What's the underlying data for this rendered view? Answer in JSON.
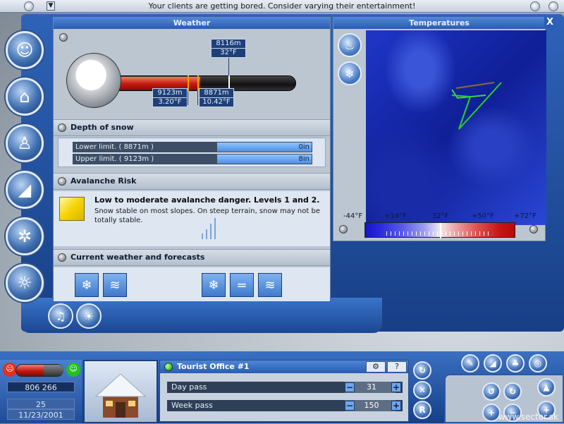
{
  "notification": {
    "text": "Your clients are getting bored. Consider varying their entertainment!"
  },
  "weather": {
    "title": "Weather",
    "gauge": {
      "current_altitude": "8116m",
      "current_temp": "32°F",
      "lower_altitude": "9123m",
      "lower_temp": "3.20°F",
      "upper_altitude": "8871m",
      "upper_temp": "10.42°F"
    },
    "depth": {
      "heading": "Depth of snow",
      "rows": [
        {
          "label": "Lower limit. ( 8871m )",
          "value": "0in"
        },
        {
          "label": "Upper limit. ( 9123m )",
          "value": "8in"
        }
      ]
    },
    "avalanche": {
      "heading": "Avalanche Risk",
      "title": "Low to moderate avalanche danger. Levels 1 and 2.",
      "text": "Snow stable on most slopes. On steep terrain, snow may not be totally stable.",
      "level": 2
    },
    "forecast": {
      "heading": "Current weather and forecasts",
      "icons": [
        "snowflake-icon",
        "wind-icon",
        "snowflake-icon",
        "thermometer-equal-icon",
        "wind-icon"
      ]
    }
  },
  "temperatures": {
    "title": "Temperatures",
    "close": "X",
    "scale": [
      "-44°F",
      "+14°F",
      "32°F",
      "+50°F",
      "+72°F"
    ]
  },
  "status": {
    "money": "806 266",
    "day": "25",
    "date": "11/23/2001"
  },
  "office": {
    "title": "Tourist Office #1",
    "rows": [
      {
        "label": "Day pass",
        "value": "31"
      },
      {
        "label": "Week pass",
        "value": "150"
      }
    ],
    "minus": "−",
    "plus": "+"
  },
  "side_buttons": {
    "r_label": "R",
    "x_label": "✕"
  },
  "watermark": "www.sector.sk",
  "colors": {
    "frame": "#2e63b8",
    "thermo_red": "#c41b10",
    "snow_blue": "#4f8fe0",
    "warning_yellow": "#f5d400"
  }
}
